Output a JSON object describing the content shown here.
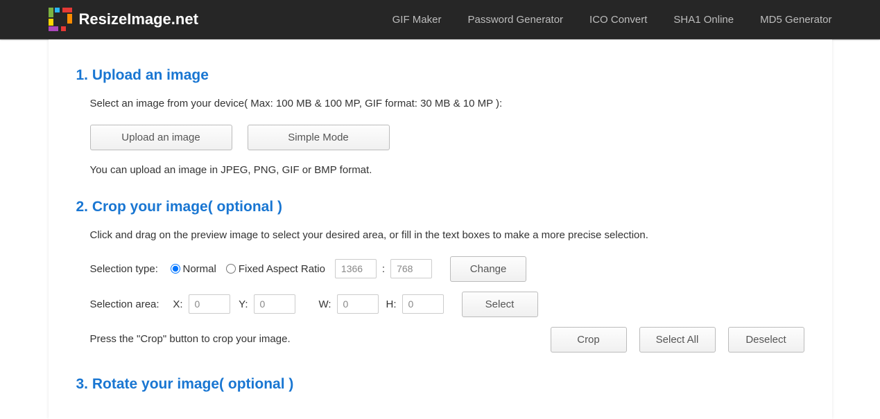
{
  "header": {
    "site_name": "ResizeImage.net",
    "nav": [
      "GIF Maker",
      "Password Generator",
      "ICO Convert",
      "SHA1 Online",
      "MD5 Generator"
    ]
  },
  "sections": {
    "upload": {
      "title": "1. Upload an image",
      "intro": "Select an image from your device( Max: 100 MB & 100 MP, GIF format: 30 MB & 10 MP ):",
      "upload_btn": "Upload an image",
      "simple_btn": "Simple Mode",
      "note": "You can upload an image in JPEG, PNG, GIF or BMP format."
    },
    "crop": {
      "title": "2. Crop your image( optional )",
      "intro": "Click and drag on the preview image to select your desired area, or fill in the text boxes to make a more precise selection.",
      "selection_type_label": "Selection type:",
      "radio_normal": "Normal",
      "radio_fixed": "Fixed Aspect Ratio",
      "aspect_w": "1366",
      "aspect_sep": ":",
      "aspect_h": "768",
      "change_btn": "Change",
      "selection_area_label": "Selection area:",
      "x_label": "X:",
      "y_label": "Y:",
      "w_label": "W:",
      "h_label": "H:",
      "x_val": "0",
      "y_val": "0",
      "w_val": "0",
      "h_val": "0",
      "select_btn": "Select",
      "press_note": "Press the \"Crop\" button to crop your image.",
      "crop_btn": "Crop",
      "select_all_btn": "Select All",
      "deselect_btn": "Deselect"
    },
    "rotate": {
      "title": "3. Rotate your image( optional )"
    }
  }
}
